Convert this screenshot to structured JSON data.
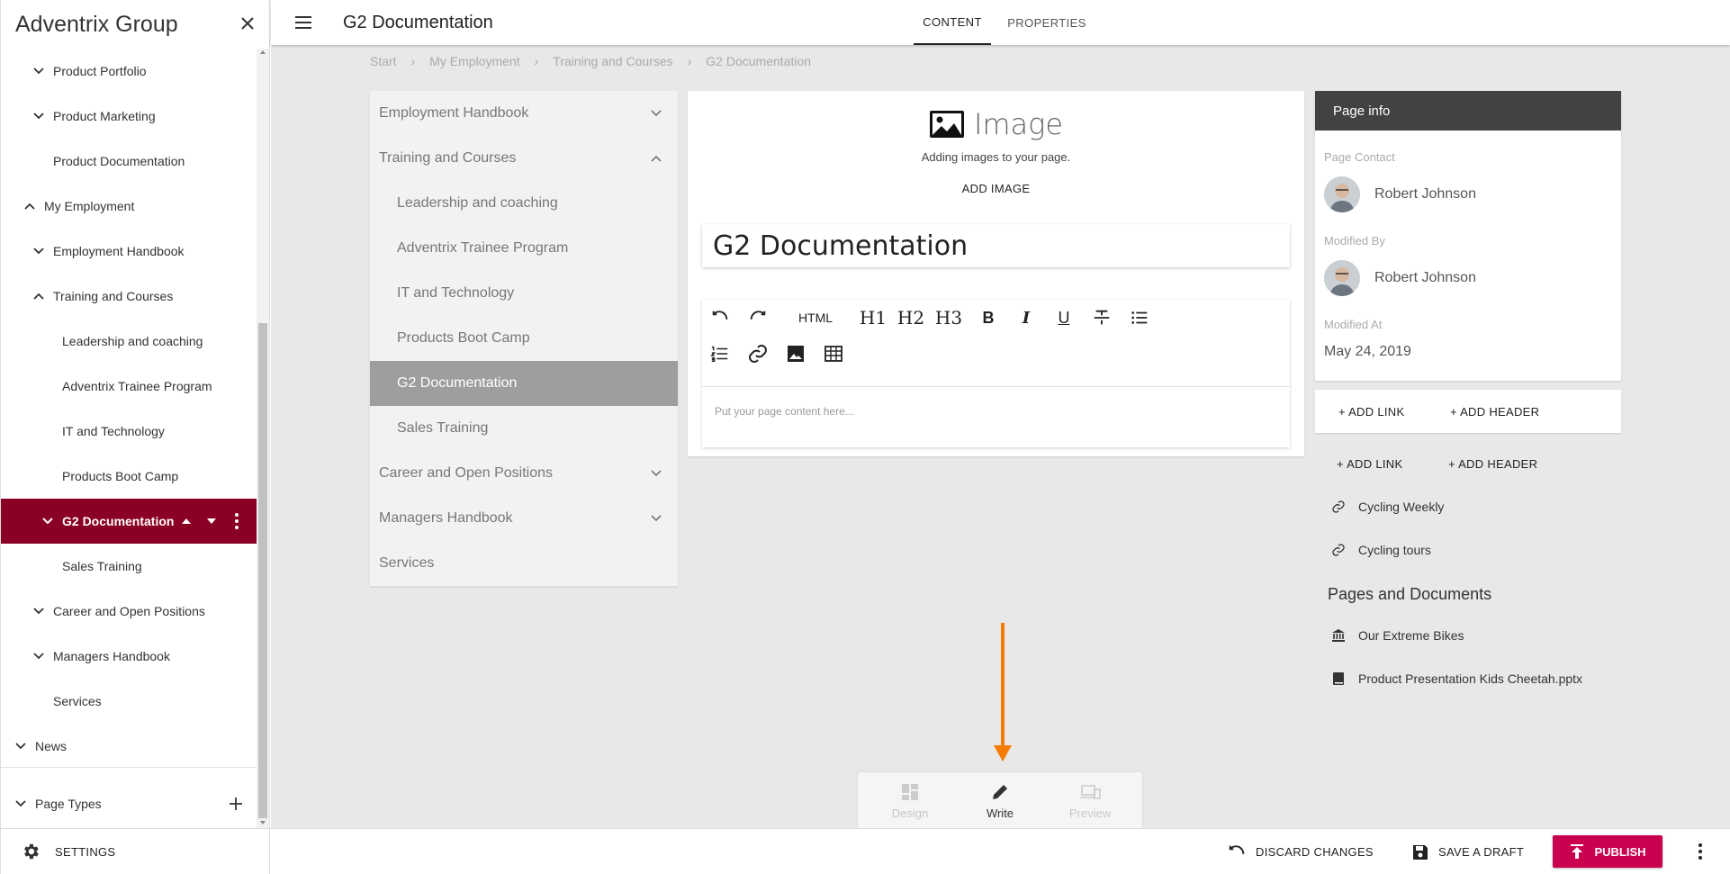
{
  "sidebar": {
    "title": "Adventrix Group",
    "tree": [
      {
        "label": "Product Portfolio",
        "chevron": "down"
      },
      {
        "label": "Product Marketing",
        "chevron": "down"
      },
      {
        "label": "Product Documentation",
        "chevron": ""
      },
      {
        "label": "My Employment",
        "chevron": "up"
      },
      {
        "label": "Employment Handbook",
        "chevron": "down"
      },
      {
        "label": "Training and Courses",
        "chevron": "up"
      },
      {
        "label": "Leadership and coaching",
        "chevron": ""
      },
      {
        "label": "Adventrix Trainee Program",
        "chevron": ""
      },
      {
        "label": "IT and Technology",
        "chevron": ""
      },
      {
        "label": "Products Boot Camp",
        "chevron": ""
      },
      {
        "label": "G2 Documentation",
        "chevron": "down"
      },
      {
        "label": "Sales Training",
        "chevron": ""
      },
      {
        "label": "Career and Open Positions",
        "chevron": "down"
      },
      {
        "label": "Managers Handbook",
        "chevron": "down"
      },
      {
        "label": "Services",
        "chevron": ""
      },
      {
        "label": "News",
        "chevron": "down"
      }
    ],
    "page_types": "Page Types",
    "settings": "SETTINGS"
  },
  "header": {
    "title": "G2 Documentation",
    "tabs": [
      {
        "label": "CONTENT"
      },
      {
        "label": "PROPERTIES"
      }
    ]
  },
  "breadcrumb": [
    "Start",
    "My Employment",
    "Training and Courses",
    "G2 Documentation"
  ],
  "nav": [
    {
      "label": "Employment Handbook",
      "chevron": "down"
    },
    {
      "label": "Training and Courses",
      "chevron": "up"
    },
    {
      "label": "Leadership and coaching",
      "chevron": ""
    },
    {
      "label": "Adventrix Trainee Program",
      "chevron": ""
    },
    {
      "label": "IT and Technology",
      "chevron": ""
    },
    {
      "label": "Products Boot Camp",
      "chevron": ""
    },
    {
      "label": "G2 Documentation",
      "chevron": ""
    },
    {
      "label": "Sales Training",
      "chevron": ""
    },
    {
      "label": "Career and Open Positions",
      "chevron": "down"
    },
    {
      "label": "Managers Handbook",
      "chevron": "down"
    },
    {
      "label": "Services",
      "chevron": ""
    }
  ],
  "editor": {
    "image_title": "Image",
    "image_desc": "Adding images to your page.",
    "add_image": "ADD IMAGE",
    "page_title_value": "G2 Documentation",
    "toolbar": {
      "html": "HTML",
      "h1": "H1",
      "h2": "H2",
      "h3": "H3",
      "bold": "B",
      "italic": "I",
      "underline": "U"
    },
    "placeholder": "Put your page content here..."
  },
  "page_info": {
    "heading": "Page info",
    "contact_label": "Page Contact",
    "contact_name": "Robert Johnson",
    "modified_by_label": "Modified By",
    "modified_by_name": "Robert Johnson",
    "modified_at_label": "Modified At",
    "modified_at": "May 24, 2019"
  },
  "links": {
    "add_link": "+ ADD LINK",
    "add_header": "+ ADD HEADER",
    "items": [
      "Cycling Weekly",
      "Cycling tours"
    ]
  },
  "pages_docs": {
    "heading": "Pages and Documents",
    "items": [
      "Our Extreme Bikes",
      "Product Presentation Kids Cheetah.pptx"
    ]
  },
  "modes": [
    {
      "label": "Design"
    },
    {
      "label": "Write"
    },
    {
      "label": "Preview"
    }
  ],
  "bottom": {
    "discard": "DISCARD CHANGES",
    "save": "SAVE A DRAFT",
    "publish": "PUBLISH"
  },
  "colors": {
    "active_tree": "#8a0024",
    "publish": "#c8004f",
    "arrow": "#f57c00",
    "info_header": "#424242"
  }
}
